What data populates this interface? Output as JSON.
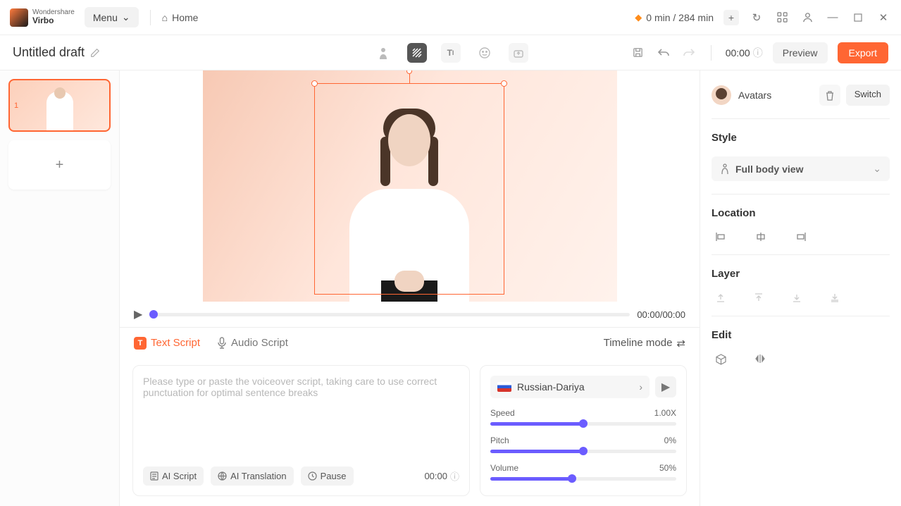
{
  "app": {
    "brand_top": "Wondershare",
    "brand_name": "Virbo",
    "menu": "Menu",
    "home": "Home"
  },
  "credits": {
    "text": "0 min / 284 min"
  },
  "draft": {
    "title": "Untitled draft"
  },
  "secondbar": {
    "time": "00:00",
    "preview": "Preview",
    "export": "Export"
  },
  "slides": {
    "num": "1"
  },
  "playbar": {
    "time": "00:00/00:00"
  },
  "tabs": {
    "text": "Text Script",
    "audio": "Audio Script",
    "timeline": "Timeline mode"
  },
  "script": {
    "placeholder": "Please type or paste the voiceover script, taking care to use correct punctuation for optimal sentence breaks",
    "ai_script": "AI Script",
    "ai_translation": "AI Translation",
    "pause": "Pause",
    "time": "00:00"
  },
  "voice": {
    "name": "Russian-Dariya",
    "speed_label": "Speed",
    "speed_value": "1.00X",
    "pitch_label": "Pitch",
    "pitch_value": "0%",
    "volume_label": "Volume",
    "volume_value": "50%"
  },
  "right": {
    "avatars": "Avatars",
    "switch": "Switch",
    "style": "Style",
    "style_value": "Full body view",
    "location": "Location",
    "layer": "Layer",
    "edit": "Edit"
  }
}
